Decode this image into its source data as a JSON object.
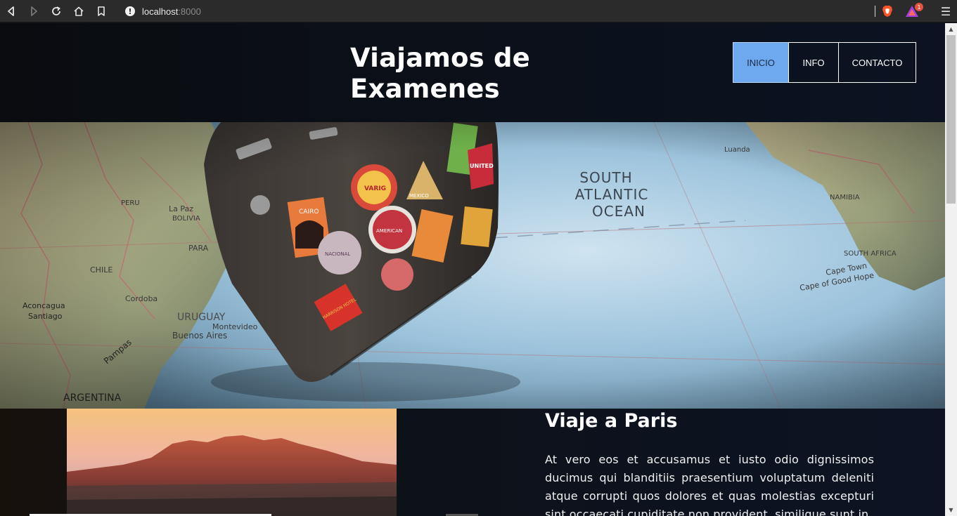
{
  "browser": {
    "url_host": "localhost",
    "url_port": ":8000",
    "rewards_badge": "1"
  },
  "header": {
    "title": "Viajamos de Examenes",
    "nav": [
      {
        "label": "INICIO",
        "active": true
      },
      {
        "label": "INFO",
        "active": false
      },
      {
        "label": "CONTACTO",
        "active": false
      }
    ]
  },
  "hero": {
    "map_labels": {
      "ocean": [
        "SOUTH",
        "ATLANTIC",
        "OCEAN"
      ],
      "places": [
        "La Paz",
        "BOLIVIA",
        "PERU",
        "CHILE",
        "PARA",
        "Cordoba",
        "Aconcagua",
        "Santiago",
        "URUGUAY",
        "Montevideo",
        "Buenos Aires",
        "Pampas",
        "ARGENTINA",
        "Cape Town",
        "Cape of Good Hope",
        "SOUTH AFRICA",
        "NAMIBIA",
        "Luanda"
      ],
      "stickers": [
        "CAIRO",
        "VARIG",
        "MEXICO",
        "UNITED",
        "AMERICAN",
        "NACIONAL",
        "HARRISON HOTEL"
      ]
    }
  },
  "trip": {
    "title": "Viaje a Paris",
    "text": "At vero eos et accusamus et iusto odio dignissimos ducimus qui blanditiis praesentium voluptatum deleniti atque corrupti quos dolores et quas molestias excepturi sint occaecati cupiditate non provident, similique sunt in"
  },
  "colors": {
    "nav_active": "#6ea9f0",
    "header_bg": "#0b1019",
    "map_ocean": "#9cc3dc"
  }
}
